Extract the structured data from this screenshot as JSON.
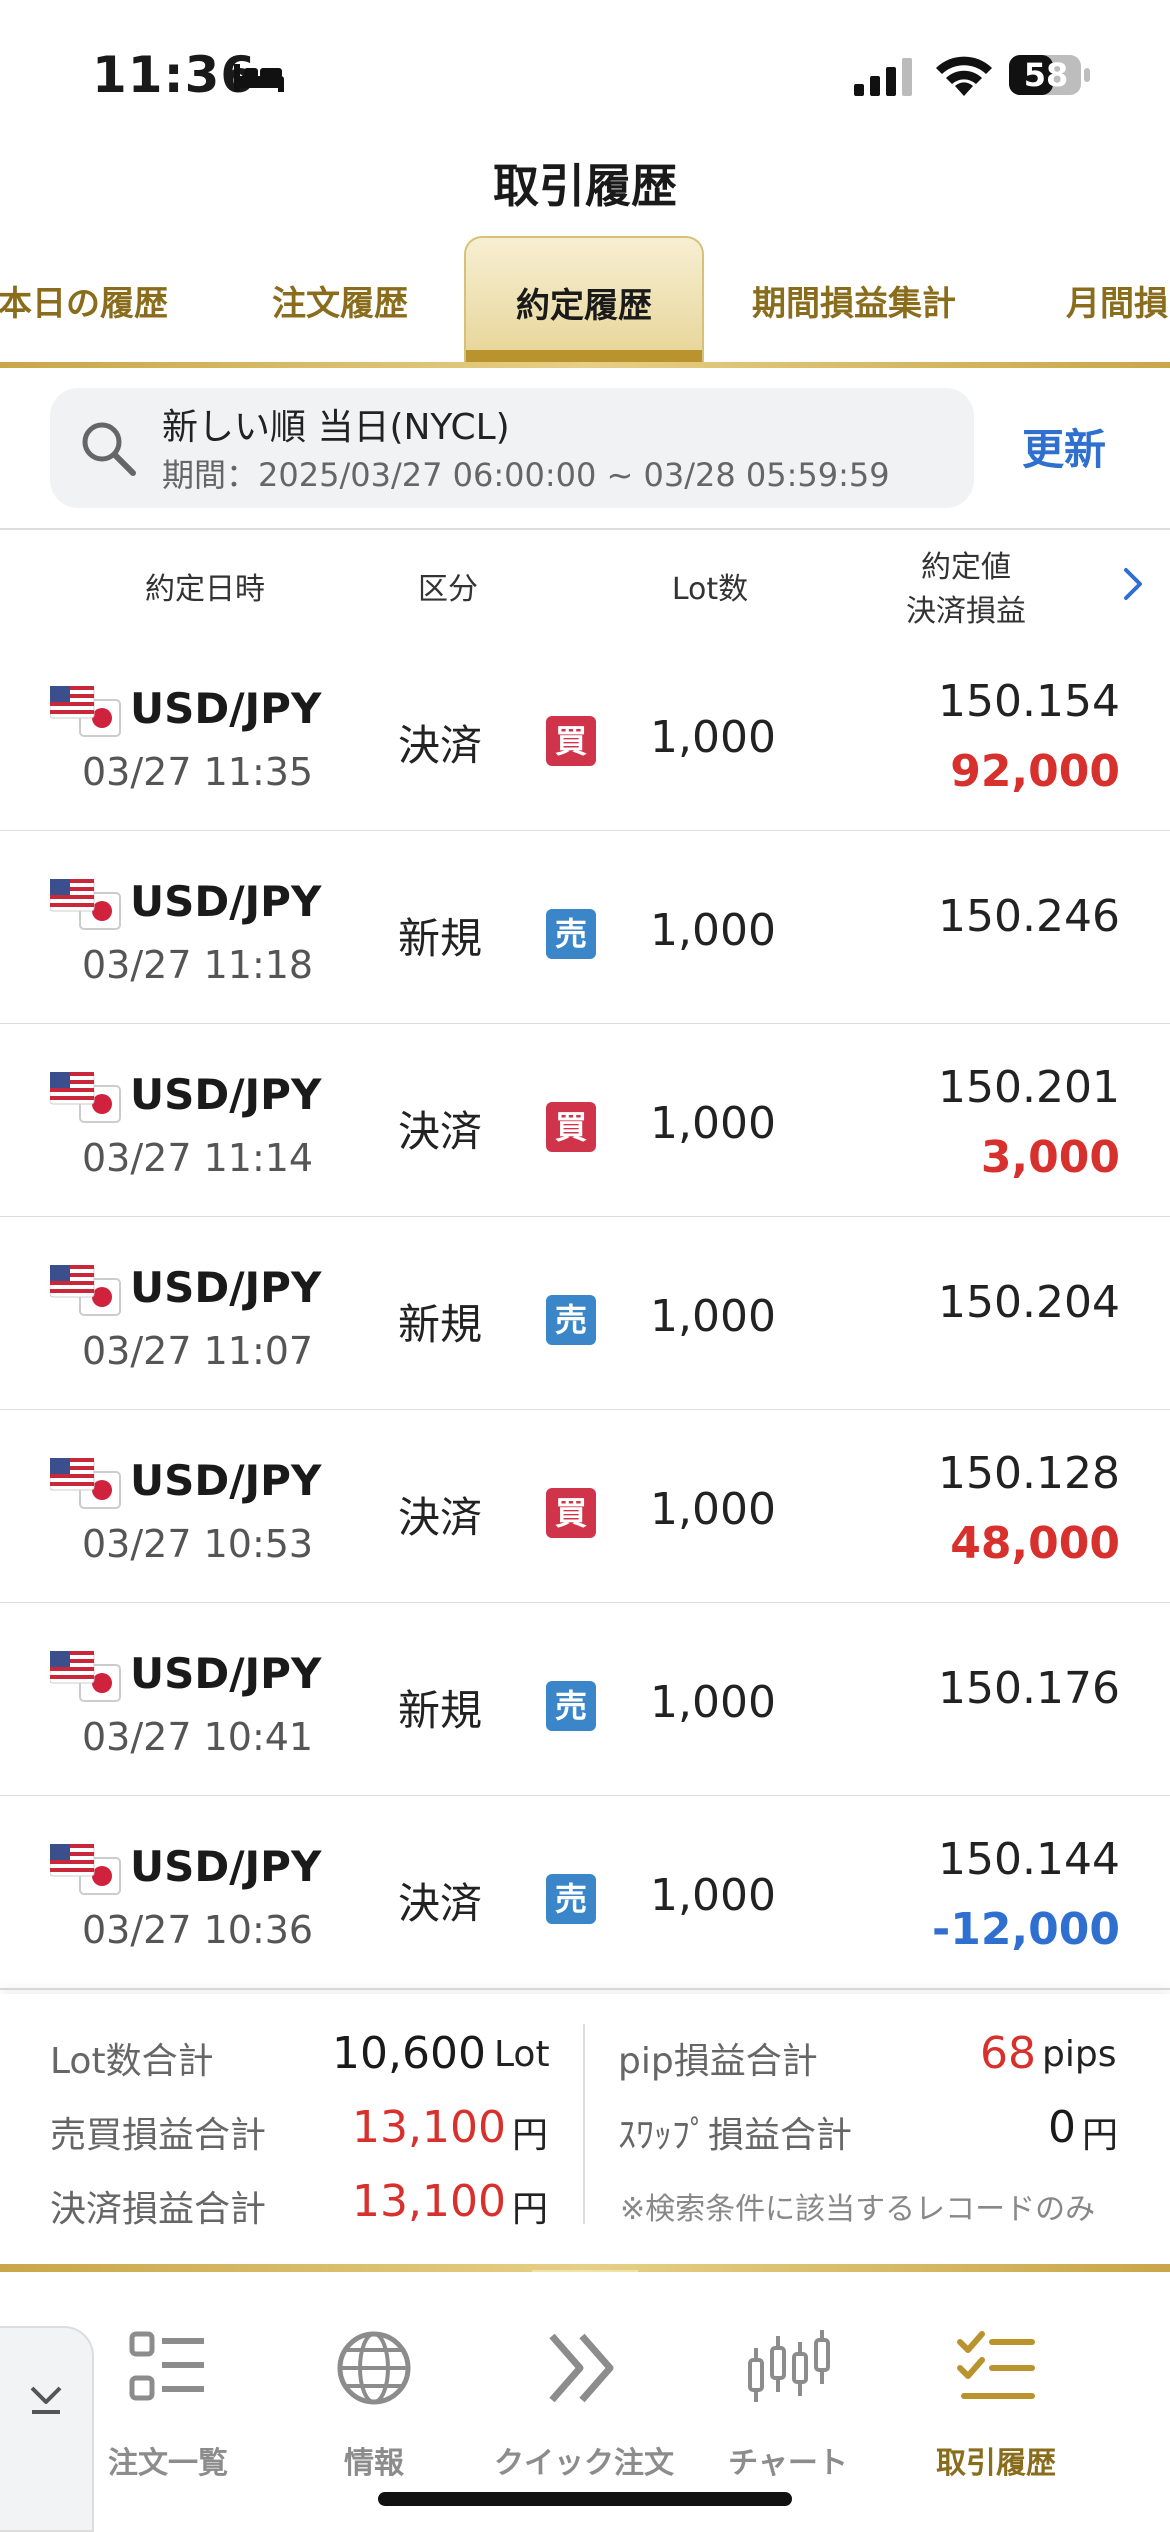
{
  "status": {
    "time": "11:36",
    "battery": "58"
  },
  "title": "取引履歴",
  "tabs": [
    "本日の履歴",
    "注文履歴",
    "約定履歴",
    "期間損益集計",
    "月間損"
  ],
  "search": {
    "line1": "新しい順 当日(NYCL)",
    "line2": "期間：2025/03/27 06:00:00 ~ 03/28 05:59:59",
    "refresh": "更新"
  },
  "columns": {
    "datetime": "約定日時",
    "kind": "区分",
    "lot": "Lot数",
    "price": "約定値",
    "pnl": "決済損益"
  },
  "rows": [
    {
      "pair": "USD/JPY",
      "date": "03/27 11:35",
      "kind": "決済",
      "side": "買",
      "lot": "1,000",
      "price": "150.154",
      "pnl": "92,000"
    },
    {
      "pair": "USD/JPY",
      "date": "03/27 11:18",
      "kind": "新規",
      "side": "売",
      "lot": "1,000",
      "price": "150.246",
      "pnl": ""
    },
    {
      "pair": "USD/JPY",
      "date": "03/27 11:14",
      "kind": "決済",
      "side": "買",
      "lot": "1,000",
      "price": "150.201",
      "pnl": "3,000"
    },
    {
      "pair": "USD/JPY",
      "date": "03/27 11:07",
      "kind": "新規",
      "side": "売",
      "lot": "1,000",
      "price": "150.204",
      "pnl": ""
    },
    {
      "pair": "USD/JPY",
      "date": "03/27 10:53",
      "kind": "決済",
      "side": "買",
      "lot": "1,000",
      "price": "150.128",
      "pnl": "48,000"
    },
    {
      "pair": "USD/JPY",
      "date": "03/27 10:41",
      "kind": "新規",
      "side": "売",
      "lot": "1,000",
      "price": "150.176",
      "pnl": ""
    },
    {
      "pair": "USD/JPY",
      "date": "03/27 10:36",
      "kind": "決済",
      "side": "売",
      "lot": "1,000",
      "price": "150.144",
      "pnl": "-12,000"
    }
  ],
  "summary": {
    "lot_total_label": "Lot数合計",
    "lot_total": "10,600",
    "lot_unit": "Lot",
    "trade_pnl_label": "売買損益合計",
    "trade_pnl": "13,100",
    "yen": "円",
    "settle_pnl_label": "決済損益合計",
    "settle_pnl": "13,100",
    "pip_label": "pip損益合計",
    "pip": "68",
    "pip_unit": "pips",
    "swap_label": "ｽﾜｯﾌﾟ損益合計",
    "swap": "0",
    "note": "※検索条件に該当するレコードのみ"
  },
  "nav": [
    "注文一覧",
    "情報",
    "クイック注文",
    "チャート",
    "取引履歴"
  ],
  "colors": {
    "gold": "#b8932e",
    "buy": "#d0344a",
    "sell": "#3a86c8",
    "profit": "#d8302c",
    "loss": "#2f6fcf"
  }
}
